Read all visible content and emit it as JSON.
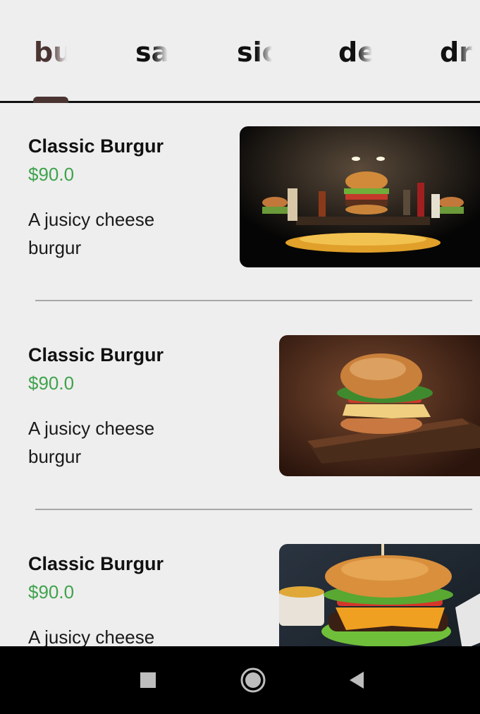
{
  "tabs": [
    {
      "label": "bu",
      "color": "#4a3432",
      "selected": true
    },
    {
      "label": "sa",
      "color": "#111111",
      "selected": false
    },
    {
      "label": "sic",
      "color": "#111111",
      "selected": false
    },
    {
      "label": "de",
      "color": "#111111",
      "selected": false
    },
    {
      "label": "dri",
      "color": "#111111",
      "selected": false
    }
  ],
  "menu": {
    "items": [
      {
        "name": "Classic Burgur",
        "price": "$90.0",
        "description": " A jusicy cheese burgur",
        "image": "burger-feast-spotlight-photo"
      },
      {
        "name": "Classic Burgur",
        "price": "$90.0",
        "description": " A jusicy cheese burgur",
        "image": "burger-on-wooden-board-photo"
      },
      {
        "name": "Classic Burgur",
        "price": "$90.0",
        "description": " A jusicy cheese burgur",
        "image": "cheeseburger-closeup-photo"
      }
    ]
  },
  "navbar": {
    "buttons": [
      "recents-square-icon",
      "home-circle-icon",
      "back-triangle-icon"
    ]
  },
  "colors": {
    "background": "#efeeee",
    "price": "#3fa34d",
    "tab_indicator": "#4a3432",
    "navbar": "#000000"
  }
}
